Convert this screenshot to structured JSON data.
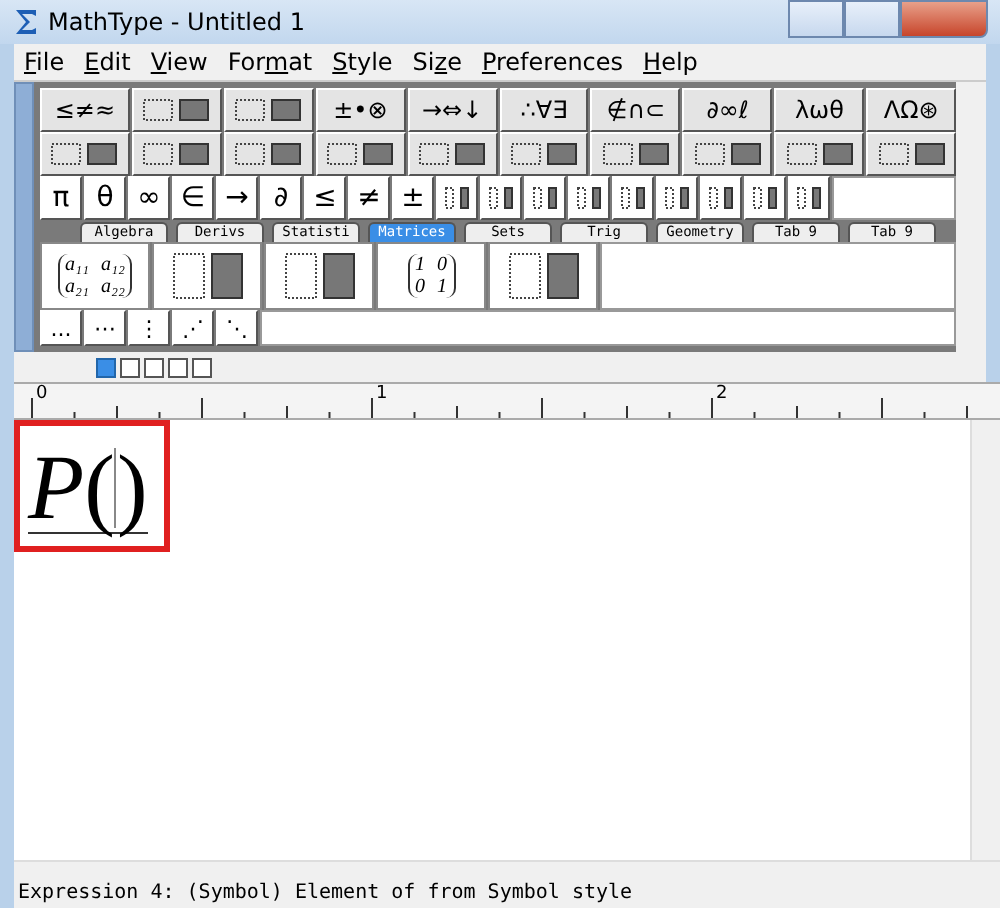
{
  "window": {
    "title": "MathType - Untitled 1"
  },
  "menu": [
    {
      "key": "F",
      "rest": "ile"
    },
    {
      "key": "E",
      "rest": "dit"
    },
    {
      "key": "V",
      "rest": "iew"
    },
    {
      "pre": "For",
      "key": "m",
      "rest": "at"
    },
    {
      "key": "S",
      "rest": "tyle"
    },
    {
      "pre": "Si",
      "key": "z",
      "rest": "e"
    },
    {
      "key": "P",
      "rest": "references"
    },
    {
      "key": "H",
      "rest": "elp"
    }
  ],
  "palette_rows": [
    [
      {
        "kind": "text",
        "label": "≤≠≈"
      },
      {
        "kind": "template"
      },
      {
        "kind": "template"
      },
      {
        "kind": "text",
        "label": "±•⊗"
      },
      {
        "kind": "text",
        "label": "→⇔↓"
      },
      {
        "kind": "text",
        "label": "∴∀∃"
      },
      {
        "kind": "text",
        "label": "∉∩⊂"
      },
      {
        "kind": "text",
        "label": "∂∞ℓ"
      },
      {
        "kind": "text",
        "label": "λωθ"
      },
      {
        "kind": "text",
        "label": "ΛΩ⊛"
      }
    ],
    [
      {
        "kind": "template"
      },
      {
        "kind": "template"
      },
      {
        "kind": "template"
      },
      {
        "kind": "template"
      },
      {
        "kind": "template"
      },
      {
        "kind": "template"
      },
      {
        "kind": "template"
      },
      {
        "kind": "template"
      },
      {
        "kind": "template"
      },
      {
        "kind": "template"
      }
    ]
  ],
  "symbol_bar": [
    {
      "kind": "text",
      "label": "π"
    },
    {
      "kind": "text",
      "label": "θ"
    },
    {
      "kind": "text",
      "label": "∞"
    },
    {
      "kind": "text",
      "label": "∈"
    },
    {
      "kind": "text",
      "label": "→"
    },
    {
      "kind": "text",
      "label": "∂"
    },
    {
      "kind": "text",
      "label": "≤"
    },
    {
      "kind": "text",
      "label": "≠"
    },
    {
      "kind": "text",
      "label": "±"
    },
    {
      "kind": "template"
    },
    {
      "kind": "template"
    },
    {
      "kind": "template"
    },
    {
      "kind": "template"
    },
    {
      "kind": "template"
    },
    {
      "kind": "template"
    },
    {
      "kind": "template"
    },
    {
      "kind": "template"
    },
    {
      "kind": "template"
    }
  ],
  "tabs": [
    {
      "label": "Algebra",
      "selected": false
    },
    {
      "label": "Derivs",
      "selected": false
    },
    {
      "label": "Statisti",
      "selected": false
    },
    {
      "label": "Matrices",
      "selected": true
    },
    {
      "label": "Sets",
      "selected": false
    },
    {
      "label": "Trig",
      "selected": false
    },
    {
      "label": "Geometry",
      "selected": false
    },
    {
      "label": "Tab 9",
      "selected": false
    },
    {
      "label": "Tab 9",
      "selected": false
    }
  ],
  "matrix_templates": [
    {
      "kind": "grid",
      "cells": [
        [
          "a₁₁",
          "a₁₂"
        ],
        [
          "a₂₁",
          "a₂₂"
        ]
      ]
    },
    {
      "kind": "template"
    },
    {
      "kind": "template"
    },
    {
      "kind": "grid",
      "cells": [
        [
          "1",
          "0"
        ],
        [
          "0",
          "1"
        ]
      ]
    },
    {
      "kind": "template"
    }
  ],
  "dots": [
    "...",
    "⋯",
    "⋮",
    "⋰",
    "⋱"
  ],
  "view_buttons": [
    {
      "selected": true
    },
    {
      "selected": false
    },
    {
      "selected": false
    },
    {
      "selected": false
    },
    {
      "selected": false
    }
  ],
  "ruler": {
    "labels": [
      "0",
      "1",
      "2"
    ]
  },
  "editor": {
    "variable": "P",
    "open": "(",
    "close": ")",
    "highlighted": true
  },
  "status_bar": "Expression 4: (Symbol) Element of from Symbol style"
}
